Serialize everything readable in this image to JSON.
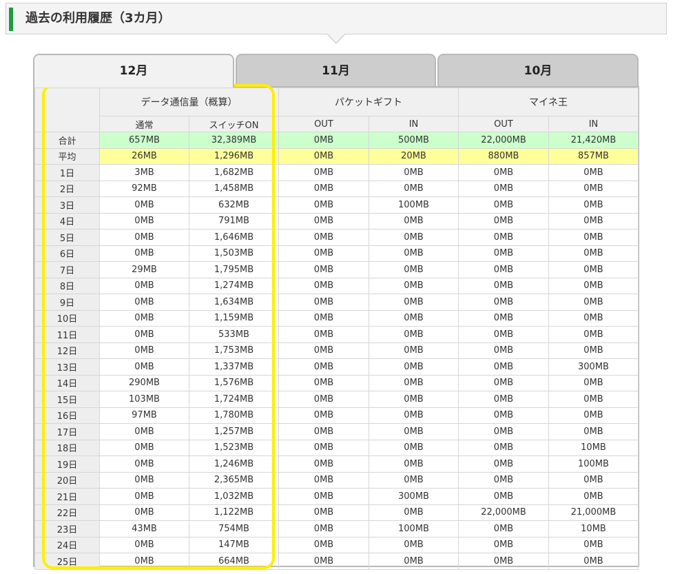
{
  "header": {
    "title": "過去の利用履歴（3カ月）"
  },
  "tabs": [
    {
      "label": "12月",
      "active": true
    },
    {
      "label": "11月",
      "active": false
    },
    {
      "label": "10月",
      "active": false
    }
  ],
  "table": {
    "groups": {
      "data": "データ通信量（概算）",
      "gift": "パケットギフト",
      "maine": "マイネ王"
    },
    "subs": {
      "normal": "通常",
      "switch_on": "スイッチON",
      "gift_out": "OUT",
      "gift_in": "IN",
      "maine_out": "OUT",
      "maine_in": "IN"
    },
    "rows": [
      {
        "label": "合計",
        "normal": "657MB",
        "switch_on": "32,389MB",
        "gift_out": "0MB",
        "gift_in": "500MB",
        "maine_out": "22,000MB",
        "maine_in": "21,420MB"
      },
      {
        "label": "平均",
        "normal": "26MB",
        "switch_on": "1,296MB",
        "gift_out": "0MB",
        "gift_in": "20MB",
        "maine_out": "880MB",
        "maine_in": "857MB"
      },
      {
        "label": "1日",
        "normal": "3MB",
        "switch_on": "1,682MB",
        "gift_out": "0MB",
        "gift_in": "0MB",
        "maine_out": "0MB",
        "maine_in": "0MB"
      },
      {
        "label": "2日",
        "normal": "92MB",
        "switch_on": "1,458MB",
        "gift_out": "0MB",
        "gift_in": "0MB",
        "maine_out": "0MB",
        "maine_in": "0MB"
      },
      {
        "label": "3日",
        "normal": "0MB",
        "switch_on": "632MB",
        "gift_out": "0MB",
        "gift_in": "100MB",
        "maine_out": "0MB",
        "maine_in": "0MB"
      },
      {
        "label": "4日",
        "normal": "0MB",
        "switch_on": "791MB",
        "gift_out": "0MB",
        "gift_in": "0MB",
        "maine_out": "0MB",
        "maine_in": "0MB"
      },
      {
        "label": "5日",
        "normal": "0MB",
        "switch_on": "1,646MB",
        "gift_out": "0MB",
        "gift_in": "0MB",
        "maine_out": "0MB",
        "maine_in": "0MB"
      },
      {
        "label": "6日",
        "normal": "0MB",
        "switch_on": "1,503MB",
        "gift_out": "0MB",
        "gift_in": "0MB",
        "maine_out": "0MB",
        "maine_in": "0MB"
      },
      {
        "label": "7日",
        "normal": "29MB",
        "switch_on": "1,795MB",
        "gift_out": "0MB",
        "gift_in": "0MB",
        "maine_out": "0MB",
        "maine_in": "0MB"
      },
      {
        "label": "8日",
        "normal": "0MB",
        "switch_on": "1,274MB",
        "gift_out": "0MB",
        "gift_in": "0MB",
        "maine_out": "0MB",
        "maine_in": "0MB"
      },
      {
        "label": "9日",
        "normal": "0MB",
        "switch_on": "1,634MB",
        "gift_out": "0MB",
        "gift_in": "0MB",
        "maine_out": "0MB",
        "maine_in": "0MB"
      },
      {
        "label": "10日",
        "normal": "0MB",
        "switch_on": "1,159MB",
        "gift_out": "0MB",
        "gift_in": "0MB",
        "maine_out": "0MB",
        "maine_in": "0MB"
      },
      {
        "label": "11日",
        "normal": "0MB",
        "switch_on": "533MB",
        "gift_out": "0MB",
        "gift_in": "0MB",
        "maine_out": "0MB",
        "maine_in": "0MB"
      },
      {
        "label": "12日",
        "normal": "0MB",
        "switch_on": "1,753MB",
        "gift_out": "0MB",
        "gift_in": "0MB",
        "maine_out": "0MB",
        "maine_in": "0MB"
      },
      {
        "label": "13日",
        "normal": "0MB",
        "switch_on": "1,337MB",
        "gift_out": "0MB",
        "gift_in": "0MB",
        "maine_out": "0MB",
        "maine_in": "300MB"
      },
      {
        "label": "14日",
        "normal": "290MB",
        "switch_on": "1,576MB",
        "gift_out": "0MB",
        "gift_in": "0MB",
        "maine_out": "0MB",
        "maine_in": "0MB"
      },
      {
        "label": "15日",
        "normal": "103MB",
        "switch_on": "1,724MB",
        "gift_out": "0MB",
        "gift_in": "0MB",
        "maine_out": "0MB",
        "maine_in": "0MB"
      },
      {
        "label": "16日",
        "normal": "97MB",
        "switch_on": "1,780MB",
        "gift_out": "0MB",
        "gift_in": "0MB",
        "maine_out": "0MB",
        "maine_in": "0MB"
      },
      {
        "label": "17日",
        "normal": "0MB",
        "switch_on": "1,257MB",
        "gift_out": "0MB",
        "gift_in": "0MB",
        "maine_out": "0MB",
        "maine_in": "0MB"
      },
      {
        "label": "18日",
        "normal": "0MB",
        "switch_on": "1,523MB",
        "gift_out": "0MB",
        "gift_in": "0MB",
        "maine_out": "0MB",
        "maine_in": "10MB"
      },
      {
        "label": "19日",
        "normal": "0MB",
        "switch_on": "1,246MB",
        "gift_out": "0MB",
        "gift_in": "0MB",
        "maine_out": "0MB",
        "maine_in": "100MB"
      },
      {
        "label": "20日",
        "normal": "0MB",
        "switch_on": "2,365MB",
        "gift_out": "0MB",
        "gift_in": "0MB",
        "maine_out": "0MB",
        "maine_in": "0MB"
      },
      {
        "label": "21日",
        "normal": "0MB",
        "switch_on": "1,032MB",
        "gift_out": "0MB",
        "gift_in": "300MB",
        "maine_out": "0MB",
        "maine_in": "0MB"
      },
      {
        "label": "22日",
        "normal": "0MB",
        "switch_on": "1,122MB",
        "gift_out": "0MB",
        "gift_in": "0MB",
        "maine_out": "22,000MB",
        "maine_in": "21,000MB"
      },
      {
        "label": "23日",
        "normal": "43MB",
        "switch_on": "754MB",
        "gift_out": "0MB",
        "gift_in": "100MB",
        "maine_out": "0MB",
        "maine_in": "10MB"
      },
      {
        "label": "24日",
        "normal": "0MB",
        "switch_on": "147MB",
        "gift_out": "0MB",
        "gift_in": "0MB",
        "maine_out": "0MB",
        "maine_in": "0MB"
      },
      {
        "label": "25日",
        "normal": "0MB",
        "switch_on": "664MB",
        "gift_out": "0MB",
        "gift_in": "0MB",
        "maine_out": "0MB",
        "maine_in": "0MB"
      }
    ]
  },
  "colors": {
    "accent_bar": "#1e9b3f",
    "total_row": "#ccffcc",
    "average_row": "#ffff99",
    "highlight_box": "#ffee00"
  }
}
